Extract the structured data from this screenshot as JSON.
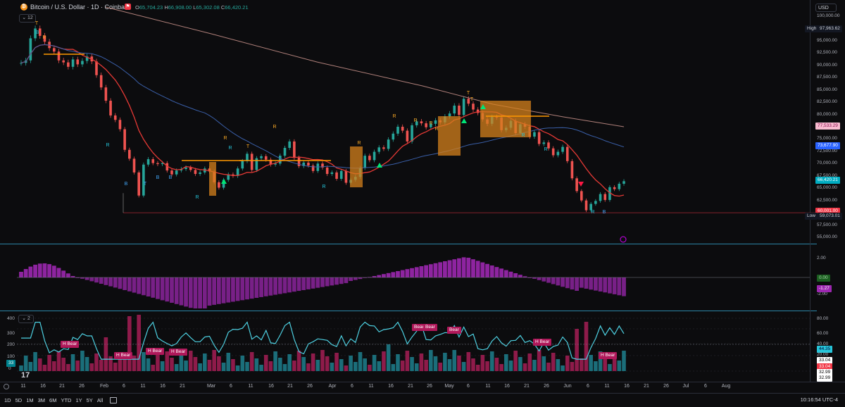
{
  "header": {
    "symbol_logo": "₿",
    "title": "Bitcoin / U.S. Dollar · 1D · Coinbase",
    "open_label": "O",
    "open": "65,704.23",
    "high_label": "H",
    "high": "66,908.00",
    "low_label": "L",
    "low": "65,302.08",
    "close_label": "C",
    "close": "66,420.21",
    "indicator_pill": "12",
    "indicator_pill2": "2",
    "currency": "USD"
  },
  "price_axis": {
    "ticks": [
      "100,000.00",
      "97,500.00",
      "95,000.00",
      "92,500.00",
      "90,000.00",
      "87,500.00",
      "85,000.00",
      "82,500.00",
      "80,000.00",
      "77,500.00",
      "75,000.00",
      "72,500.00",
      "70,000.00",
      "67,500.00",
      "65,000.00",
      "62,500.00",
      "60,000.00",
      "57,500.00",
      "55,000.00"
    ],
    "high_label": "High",
    "high_value": "97,963.62",
    "low_label": "Low",
    "low_value": "59,073.01",
    "badge_1": "77,533.29",
    "badge_2": "73,677.90",
    "badge_3": "66,420.21",
    "badge_4": "60,001.00"
  },
  "macd_axis": {
    "ticks": [
      "2.00",
      "-2.00"
    ],
    "badge_zero": "0.00",
    "badge_value": "-1.27"
  },
  "volume_axis": {
    "left_ticks": [
      "400",
      "300",
      "200",
      "100",
      "0"
    ],
    "right_ticks": [
      "80.00",
      "60.00",
      "40.00",
      "20.00"
    ],
    "badge_1": "44.35",
    "badge_2": "33.04",
    "badge_3": "33.04",
    "badge_4": "32.99",
    "badge_5": "32.99",
    "badge_left": "33"
  },
  "annotations": {
    "bear_labels": [
      "H Bear",
      "H Bear",
      "H Bear",
      "H Bear",
      "Bear",
      "Bear",
      "Bear",
      "H Bear",
      "H Bear"
    ]
  },
  "x_axis": {
    "ticks": [
      "11",
      "16",
      "21",
      "26",
      "Feb",
      "6",
      "11",
      "16",
      "21",
      "Mar",
      "6",
      "11",
      "16",
      "21",
      "26",
      "Apr",
      "6",
      "11",
      "16",
      "21",
      "26",
      "May",
      "6",
      "11",
      "16",
      "21",
      "26",
      "Jun",
      "6",
      "11",
      "16",
      "21",
      "26",
      "Jul",
      "6",
      "Aug"
    ]
  },
  "bottom_bar": {
    "ranges": [
      "1D",
      "5D",
      "1M",
      "3M",
      "6M",
      "YTD",
      "1Y",
      "5Y",
      "All"
    ],
    "clock": "10:16:54 UTC-4"
  },
  "colors": {
    "bull": "#26a69a",
    "bear": "#ef5350",
    "ema_red": "#e53935",
    "ema_blue": "#3a5fa8",
    "ma_pink": "#b0807a",
    "macd": "#9c27b0",
    "cyan": "#4dd0e1"
  },
  "chart_data": {
    "type": "candlestick",
    "y_range": [
      55000,
      100000
    ],
    "marker_letters": [
      "T",
      "R",
      "B",
      "T",
      "R",
      "R",
      "B",
      "R",
      "R",
      "T",
      "R",
      "B",
      "R",
      "R",
      "R",
      "T",
      "T",
      "R",
      "R",
      "R",
      "R",
      "B",
      "R",
      "R",
      "B"
    ]
  }
}
